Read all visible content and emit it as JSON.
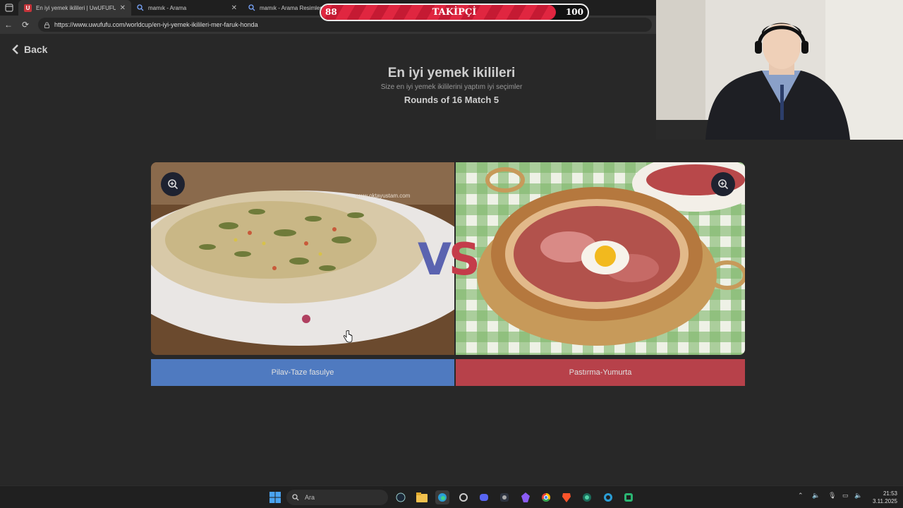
{
  "browser": {
    "tabs": [
      {
        "label": "En iyi yemek ikilileri | UwUFUFU",
        "active": true
      },
      {
        "label": "mamık - Arama",
        "active": false
      },
      {
        "label": "mamık - Arama Resimler",
        "active": false
      }
    ],
    "url": "https://www.uwufufu.com/worldcup/en-iyi-yemek-ikilileri-mer-faruk-honda"
  },
  "page": {
    "back_label": "Back",
    "title": "En iyi yemek ikilileri",
    "subtitle": "Size en iyi yemek ikililerini yaptım iyi seçimler",
    "rounds": "Rounds of 16 Match 5",
    "vs_v": "V",
    "vs_s": "S",
    "left_choice": "Pilav-Taze fasulye",
    "right_choice": "Pastırma-Yumurta",
    "left_watermark": "www.oktayustam.com"
  },
  "overlay": {
    "current": "88",
    "label": "TAKİPÇİ",
    "goal": "100",
    "progress": 0.88
  },
  "taskbar": {
    "search_placeholder": "Ara",
    "time": "21:53",
    "date": "3.11.2025"
  },
  "colors": {
    "left_accent": "#4f7ac0",
    "right_accent": "#b7414a",
    "background": "#282828"
  }
}
